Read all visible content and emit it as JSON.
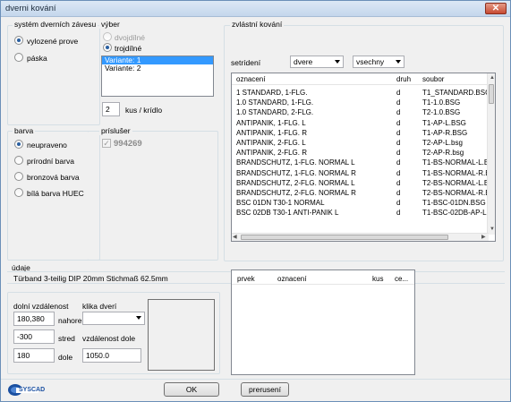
{
  "window": {
    "title": "dverni kování",
    "close_label": "✕"
  },
  "system": {
    "label": "systém dverních závesu",
    "options": [
      {
        "label": "vylozené prove",
        "selected": true
      },
      {
        "label": "páska",
        "selected": false
      }
    ]
  },
  "vyber": {
    "label": "výber",
    "options": [
      {
        "label": "dvojdílné",
        "selected": false,
        "disabled": true
      },
      {
        "label": "trojdílné",
        "selected": true,
        "disabled": false
      }
    ],
    "variants": [
      "Variante: 1",
      "Variante: 2"
    ],
    "qty_value": "2",
    "qty_label": "kus / krídlo"
  },
  "barva": {
    "label": "barva",
    "options": [
      {
        "label": "neupraveno",
        "selected": true
      },
      {
        "label": "prírodní barva",
        "selected": false
      },
      {
        "label": "bronzová barva",
        "selected": false
      },
      {
        "label": "bílá barva HUEC",
        "selected": false
      }
    ]
  },
  "prislusenstvi": {
    "label": "príslušer",
    "item_label": "994269",
    "checked": true
  },
  "zvlastni": {
    "label": "zvlástní kování",
    "sort_label": "setrídení",
    "sort_value": "dvere",
    "filter_value": "vsechny",
    "columns": [
      "oznacení",
      "druh",
      "soubor"
    ],
    "rows": [
      [
        "1 STANDARD,   1-FLG.",
        "d",
        "T1_STANDARD.BSG"
      ],
      [
        "1.0 STANDARD,   1-FLG.",
        "d",
        "T1-1.0.BSG"
      ],
      [
        "1.0 STANDARD,   2-FLG.",
        "d",
        "T2-1.0.BSG"
      ],
      [
        "ANTIPANIK,       1-FLG.  L",
        "d",
        "T1-AP-L.BSG"
      ],
      [
        "ANTIPANIK,       1-FLG.  R",
        "d",
        "T1-AP-R.BSG"
      ],
      [
        "ANTIPANIK,       2-FLG.  L",
        "d",
        "T2-AP-L.bsg"
      ],
      [
        "ANTIPANIK,       2-FLG.  R",
        "d",
        "T2-AP-R.bsg"
      ],
      [
        "BRANDSCHUTZ,  1-FLG.  NORMAL  L",
        "d",
        "T1-BS-NORMAL-L.BS"
      ],
      [
        "BRANDSCHUTZ,  1-FLG.  NORMAL  R",
        "d",
        "T1-BS-NORMAL-R.B"
      ],
      [
        "BRANDSCHUTZ,  2-FLG.  NORMAL  L",
        "d",
        "T2-BS-NORMAL-L.BS"
      ],
      [
        "BRANDSCHUTZ,  2-FLG.  NORMAL  R",
        "d",
        "T2-BS-NORMAL-R.B"
      ],
      [
        "BSC 01DN   T30-1  NORMAL",
        "d",
        "T1-BSC-01DN.BSG"
      ],
      [
        "BSC 02DB   T30-1  ANTI-PANIK  L",
        "d",
        "T1-BSC-02DB-AP-L.B"
      ]
    ]
  },
  "udaje": {
    "label": "údaje",
    "text": "Türband 3-teilig   DIP 20mm   Stichmaß 62.5mm"
  },
  "dolni": {
    "label": "dolní vzdálenost",
    "klika_label": "klika dverí",
    "value1": "180,380",
    "nahore_label": "nahore",
    "value2": "-300",
    "stred_label": "stred",
    "vzdalenost_label": "vzdálenost dole",
    "value3": "180",
    "dole_label": "dole",
    "dole_value": "1050.0"
  },
  "prvek": {
    "columns": [
      "prvek",
      "oznacení",
      "kus",
      "ce..."
    ]
  },
  "buttons": {
    "ok": "OK",
    "cancel": "prerusení"
  },
  "logo": {
    "text": "SYSCAD",
    "color": "#1a4fa0"
  }
}
